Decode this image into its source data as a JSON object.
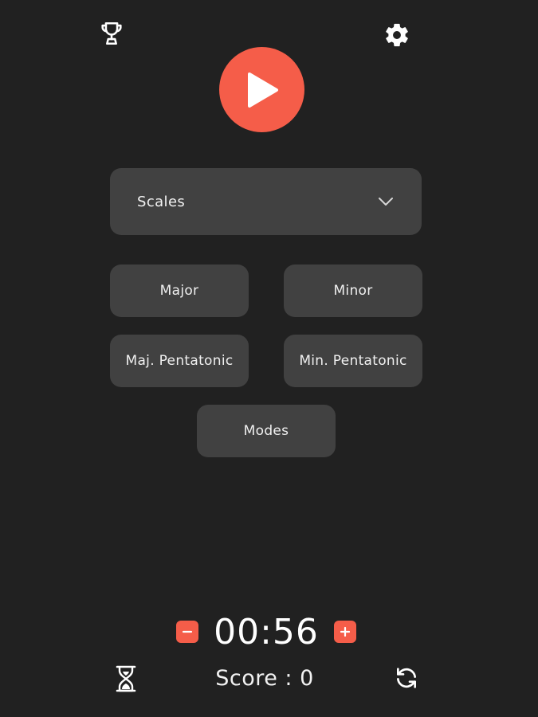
{
  "header": {
    "trophy_icon": "trophy-icon",
    "settings_icon": "gear-icon",
    "play_icon": "play-icon"
  },
  "category_dropdown": {
    "selected": "Scales",
    "icon": "chevron-down-icon"
  },
  "options": {
    "major": "Major",
    "minor": "Minor",
    "maj_pentatonic": "Maj. Pentatonic",
    "min_pentatonic": "Min. Pentatonic",
    "modes": "Modes"
  },
  "timer": {
    "value": "00:56",
    "decrease_icon": "minus-icon",
    "increase_icon": "plus-icon"
  },
  "footer": {
    "score_text": "Score : 0",
    "hourglass_icon": "hourglass-icon",
    "refresh_icon": "refresh-icon"
  },
  "colors": {
    "background": "#212121",
    "card": "#414141",
    "accent": "#f55d49",
    "text": "#ffffff"
  }
}
